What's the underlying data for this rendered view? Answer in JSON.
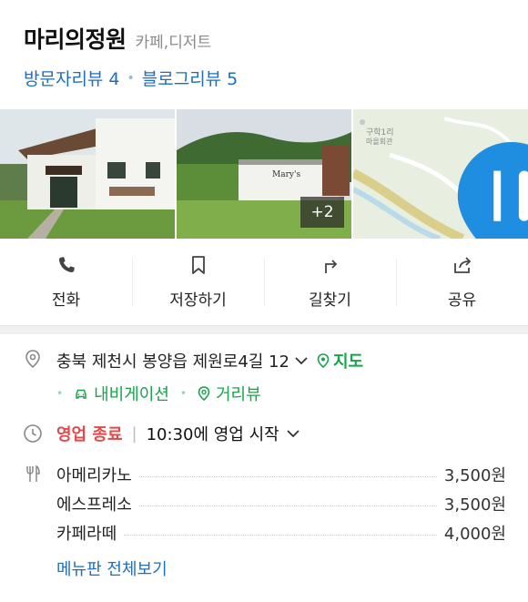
{
  "place": {
    "name": "마리의정원",
    "category": "카페,디저트"
  },
  "reviews": {
    "visitor_label": "방문자리뷰",
    "visitor_count": "4",
    "blog_label": "블로그리뷰",
    "blog_count": "5"
  },
  "gallery": {
    "more_badge": "+2"
  },
  "actions": [
    {
      "label": "전화",
      "icon": "phone-icon"
    },
    {
      "label": "저장하기",
      "icon": "bookmark-icon"
    },
    {
      "label": "길찾기",
      "icon": "directions-icon"
    },
    {
      "label": "공유",
      "icon": "share-icon"
    }
  ],
  "address": {
    "text": "충북 제천시 봉양읍 제원로4길 12",
    "map_link": "지도",
    "nav_link": "내비게이션",
    "street_view_link": "거리뷰"
  },
  "hours": {
    "status": "영업 종료",
    "detail": "10:30에 영업 시작"
  },
  "menu": {
    "items": [
      {
        "name": "아메리카노",
        "price": "3,500원"
      },
      {
        "name": "에스프레소",
        "price": "3,500원"
      },
      {
        "name": "카페라떼",
        "price": "4,000원"
      }
    ],
    "more_link": "메뉴판 전체보기"
  },
  "colors": {
    "link_blue": "#1d6fbe",
    "green": "#19a44b",
    "closed_red": "#e24a4a",
    "map_pin": "#1f8ee0"
  }
}
